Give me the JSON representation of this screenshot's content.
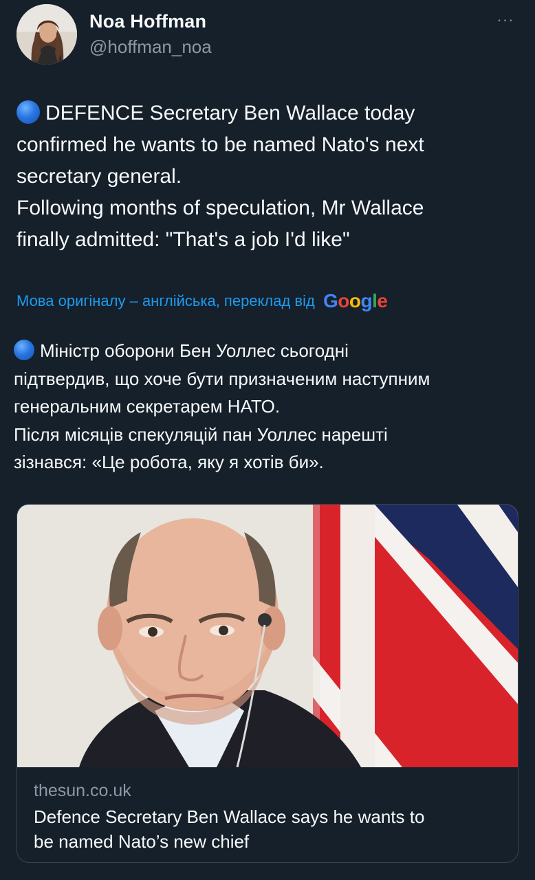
{
  "user": {
    "name": "Noa Hoffman",
    "handle": "@hoffman_noa"
  },
  "more_label": "···",
  "tweet": {
    "lines": [
      "DEFENCE Secretary Ben Wallace today",
      "confirmed he wants to be named Nato's next",
      "secretary general.",
      "Following months of speculation, Mr Wallace",
      "finally admitted: \"That's a job I'd like\""
    ]
  },
  "translation": {
    "label": "Мова оригіналу – англійська, переклад від",
    "provider": "Google",
    "lines": [
      "Міністр оборони Бен Уоллес сьогодні",
      "підтвердив, що хоче бути призначеним наступним",
      "генеральним секретарем НАТО.",
      "Після місяців спекуляцій пан Уоллес нарешті",
      "зізнався: «Це робота, яку я хотів би»."
    ]
  },
  "card": {
    "domain": "thesun.co.uk",
    "title_lines": [
      "Defence Secretary Ben Wallace says he wants to",
      "be named Nato’s new chief"
    ]
  },
  "colors": {
    "background": "#15202b",
    "text": "#f7f9f9",
    "secondary": "#8b98a5",
    "link": "#1d9bf0",
    "border": "#38444d",
    "emoji_blue_circle": "#2a76e0"
  },
  "icons": {
    "more": "more-icon",
    "emoji": "blue-circle-emoji"
  }
}
